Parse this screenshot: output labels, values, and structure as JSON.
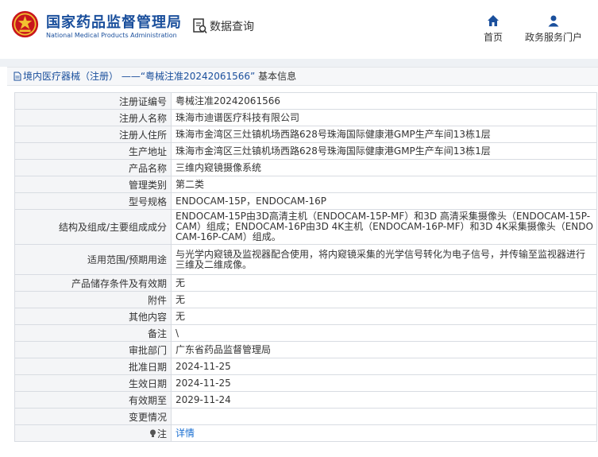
{
  "header": {
    "brand_cn": "国家药品监督管理局",
    "brand_en": "National Medical Products Administration",
    "query_title": "数据查询",
    "nav": [
      {
        "label": "首页",
        "icon": "home-icon"
      },
      {
        "label": "政务服务门户",
        "icon": "user-icon"
      }
    ]
  },
  "breadcrumb": {
    "category": "境内医疗器械（注册）",
    "separator": "——",
    "record": "“粤械注准20242061566”",
    "suffix": "基本信息"
  },
  "details": [
    {
      "label": "注册证编号",
      "value": "粤械注准20242061566"
    },
    {
      "label": "注册人名称",
      "value": "珠海市迪谱医疗科技有限公司"
    },
    {
      "label": "注册人住所",
      "value": "珠海市金湾区三灶镇机场西路628号珠海国际健康港GMP生产车间13栋1层"
    },
    {
      "label": "生产地址",
      "value": "珠海市金湾区三灶镇机场西路628号珠海国际健康港GMP生产车间13栋1层"
    },
    {
      "label": "产品名称",
      "value": "三维内窥镜摄像系统"
    },
    {
      "label": "管理类别",
      "value": "第二类"
    },
    {
      "label": "型号规格",
      "value": "ENDOCAM-15P，ENDOCAM-16P"
    },
    {
      "label": "结构及组成/主要组成成分",
      "value": "ENDOCAM-15P由3D高清主机（ENDOCAM-15P-MF）和3D 高清采集摄像头（ENDOCAM-15P-CAM）组成；ENDOCAM-16P由3D 4K主机（ENDOCAM-16P-MF）和3D 4K采集摄像头（ENDOCAM-16P-CAM）组成。"
    },
    {
      "label": "适用范围/预期用途",
      "value": "与光学内窥镜及监视器配合使用，将内窥镜采集的光学信号转化为电子信号，并传输至监视器进行三维及二维成像。"
    },
    {
      "label": "产品储存条件及有效期",
      "value": "无"
    },
    {
      "label": "附件",
      "value": "无"
    },
    {
      "label": "其他内容",
      "value": "无"
    },
    {
      "label": "备注",
      "value": "\\"
    },
    {
      "label": "审批部门",
      "value": "广东省药品监督管理局"
    },
    {
      "label": "批准日期",
      "value": "2024-11-25"
    },
    {
      "label": "生效日期",
      "value": "2024-11-25"
    },
    {
      "label": "有效期至",
      "value": "2029-11-24"
    },
    {
      "label": "变更情况",
      "value": ""
    },
    {
      "label": "注",
      "value": "详情",
      "icon": "lightbulb-icon"
    }
  ],
  "colors": {
    "brand": "#1a4f9c",
    "link": "#1a6fd1",
    "label_bg": "#f4f5f7",
    "border": "#d8dce2"
  }
}
